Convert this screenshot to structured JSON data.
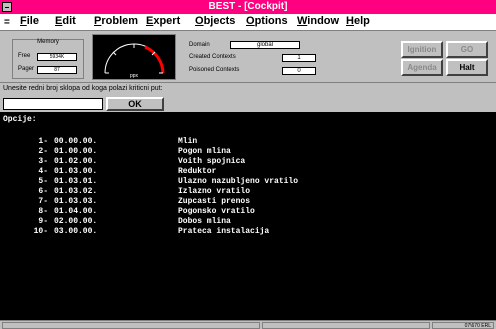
{
  "window": {
    "title": "BEST - [Cockpit]"
  },
  "menu": {
    "items": [
      "File",
      "Edit",
      "Problem",
      "Expert",
      "Objects",
      "Options",
      "Window",
      "Help"
    ]
  },
  "memory": {
    "heading": "Memory",
    "free_label": "Free",
    "free_value": "5934K",
    "pager_label": "Pager",
    "pager_value": "87"
  },
  "gauge": {
    "label": "ppx"
  },
  "domain": {
    "domain_label": "Domain",
    "domain_value": "global",
    "created_label": "Created Contexts",
    "created_value": "1",
    "poisoned_label": "Poisoned Contexts",
    "poisoned_value": "0"
  },
  "buttons": {
    "ignition": "Ignition",
    "go": "GO",
    "agenda": "Agenda",
    "halt": "Halt"
  },
  "prompt": {
    "text": "Unesite redni broj sklopa od koga polazi kriticni put:",
    "ok_label": "OK",
    "input_value": ""
  },
  "console": {
    "heading": "Opcije:",
    "rows": [
      {
        "num": "1-",
        "code": "00.00.00.",
        "name": "Mlin"
      },
      {
        "num": "2-",
        "code": "01.00.00.",
        "name": "Pogon mlina"
      },
      {
        "num": "3-",
        "code": "01.02.00.",
        "name": "Voith spojnica"
      },
      {
        "num": "4-",
        "code": "01.03.00.",
        "name": "Reduktor"
      },
      {
        "num": "5-",
        "code": "01.03.01.",
        "name": "Ulazno nazubljeno vratilo"
      },
      {
        "num": "6-",
        "code": "01.03.02.",
        "name": "Izlazno vratilo"
      },
      {
        "num": "7-",
        "code": "01.03.03.",
        "name": "Zupcasti prenos"
      },
      {
        "num": "8-",
        "code": "01.04.00.",
        "name": "Pogonsko vratilo"
      },
      {
        "num": "9-",
        "code": "02.00.00.",
        "name": "Dobos mlina"
      },
      {
        "num": "10-",
        "code": "03.00.00.",
        "name": "Prateca instalacija"
      }
    ]
  },
  "status": {
    "right_text": "07\\670 ERL"
  }
}
